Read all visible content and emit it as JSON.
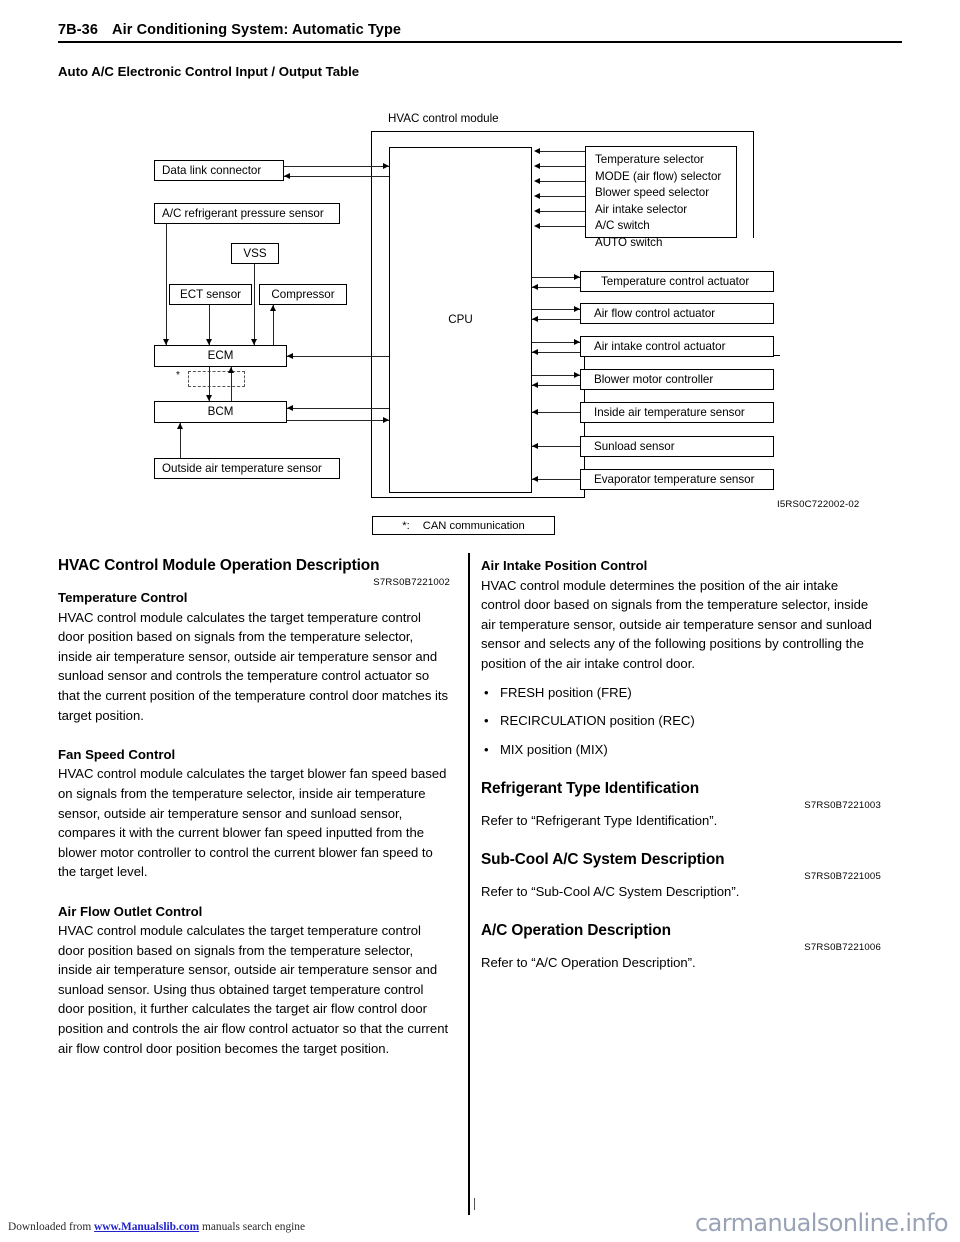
{
  "header": {
    "page_number": "7B-36",
    "title": "Air Conditioning System: Automatic Type"
  },
  "section_title": "Auto A/C Electronic Control Input / Output Table",
  "diagram": {
    "caption": "HVAC control module",
    "cpu_label": "CPU",
    "figure_id": "I5RS0C722002-02",
    "legend": {
      "marker": "*:",
      "text": "CAN communication"
    },
    "left_boxes": [
      {
        "label": "Data link connector"
      },
      {
        "label": "A/C refrigerant pressure sensor"
      },
      {
        "label": "VSS"
      },
      {
        "label": "ECT sensor"
      },
      {
        "label": "Compressor"
      },
      {
        "label": "ECM"
      },
      {
        "label": "BCM"
      },
      {
        "label": "Outside air temperature sensor"
      }
    ],
    "input_group": {
      "items": [
        "Temperature selector",
        "MODE (air flow) selector",
        "Blower speed selector",
        "Air intake selector",
        "A/C switch",
        "AUTO switch"
      ]
    },
    "right_boxes": [
      {
        "label": "Temperature control actuator",
        "bidirectional": true
      },
      {
        "label": "Air flow control actuator",
        "bidirectional": true
      },
      {
        "label": "Air intake control actuator",
        "bidirectional": true
      },
      {
        "label": "Blower motor controller",
        "bidirectional": true
      },
      {
        "label": "Inside air temperature sensor",
        "bidirectional": false
      },
      {
        "label": "Sunload sensor",
        "bidirectional": false
      },
      {
        "label": "Evaporator temperature sensor",
        "bidirectional": false
      }
    ]
  },
  "left_column": {
    "heading": "HVAC Control Module Operation Description",
    "refcode": "S7RS0B7221002",
    "sections": [
      {
        "subheading": "Temperature Control",
        "body": "HVAC control module calculates the target temperature control door position based on signals from the temperature selector, inside air temperature sensor, outside air temperature sensor and sunload sensor and controls the temperature control actuator so that the current position of the temperature control door matches its target position."
      },
      {
        "subheading": "Fan Speed Control",
        "body": "HVAC control module calculates the target blower fan speed based on signals from the temperature selector, inside air temperature sensor, outside air temperature sensor and sunload sensor, compares it with the current blower fan speed inputted from the blower motor controller to control the current blower fan speed to the target level."
      },
      {
        "subheading": "Air Flow Outlet Control",
        "body": "HVAC control module calculates the target temperature control door position based on signals from the temperature selector, inside air temperature sensor, outside air temperature sensor and sunload sensor. Using thus obtained target temperature control door position, it further calculates the target air flow control door position and controls the air flow control actuator so that the current air flow control door position becomes the target position."
      }
    ]
  },
  "right_column": {
    "intake": {
      "subheading": "Air Intake Position Control",
      "body": "HVAC control module determines the position of the air intake control door based on signals from the temperature selector, inside air temperature sensor, outside air temperature sensor and sunload sensor and selects any of the following positions by controlling the position of the air intake control door.",
      "bullets": [
        "FRESH position (FRE)",
        "RECIRCULATION position (REC)",
        "MIX position (MIX)"
      ]
    },
    "sections": [
      {
        "heading": "Refrigerant Type Identification",
        "refcode": "S7RS0B7221003",
        "body": "Refer to “Refrigerant Type Identification”."
      },
      {
        "heading": "Sub-Cool A/C System Description",
        "refcode": "S7RS0B7221005",
        "body": "Refer to “Sub-Cool A/C System Description”."
      },
      {
        "heading": "A/C Operation Description",
        "refcode": "S7RS0B7221006",
        "body": "Refer to “A/C Operation Description”."
      }
    ]
  },
  "footer": {
    "download_prefix": "Downloaded from ",
    "download_link": "www.Manualslib.com",
    "download_suffix": " manuals search engine",
    "watermark": "carmanualsonline.info"
  }
}
